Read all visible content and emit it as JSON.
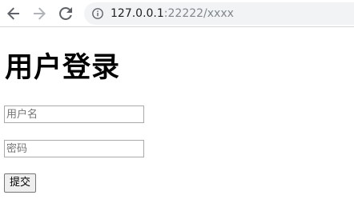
{
  "browser": {
    "url_host": "127.0.0.1",
    "url_rest": ":22222/xxxx",
    "icons": {
      "back": "back-arrow-icon",
      "forward": "forward-arrow-icon",
      "reload": "reload-icon",
      "info": "info-icon"
    }
  },
  "page": {
    "title": "用户登录",
    "username_placeholder": "用户名",
    "password_placeholder": "密码",
    "submit_label": "提交"
  }
}
